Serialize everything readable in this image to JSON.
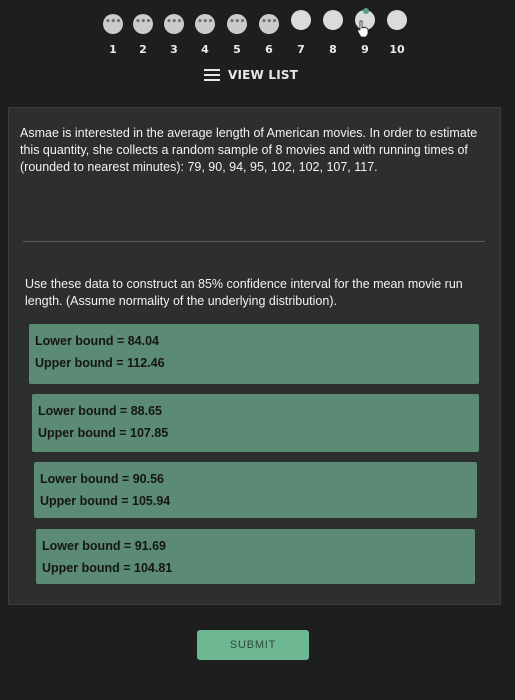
{
  "nav": {
    "questions": [
      {
        "label": "1",
        "state": "done",
        "dots": "•••"
      },
      {
        "label": "2",
        "state": "done",
        "dots": "•••"
      },
      {
        "label": "3",
        "state": "done",
        "dots": "•••"
      },
      {
        "label": "4",
        "state": "done",
        "dots": "•••"
      },
      {
        "label": "5",
        "state": "done",
        "dots": "•••"
      },
      {
        "label": "6",
        "state": "done",
        "dots": "•••"
      },
      {
        "label": "7",
        "state": "todo",
        "dots": ""
      },
      {
        "label": "8",
        "state": "todo",
        "dots": ""
      },
      {
        "label": "9",
        "state": "current",
        "dots": ""
      },
      {
        "label": "10",
        "state": "todo",
        "dots": ""
      }
    ],
    "view_list_label": "VIEW LIST"
  },
  "question": {
    "intro": "Asmae is interested in the average length of American movies. In order to estimate this quantity, she collects a random sample of 8 movies and with running times of (rounded to nearest minutes): 79, 90, 94, 95, 102, 102, 107, 117.",
    "prompt": "Use these data to construct an 85% confidence interval for the mean movie run length. (Assume normality of the underlying distribution)."
  },
  "options": [
    {
      "lower": "Lower bound = 84.04",
      "upper": "Upper bound = 112.46"
    },
    {
      "lower": "Lower bound = 88.65",
      "upper": "Upper bound = 107.85"
    },
    {
      "lower": "Lower bound = 90.56",
      "upper": "Upper bound = 105.94"
    },
    {
      "lower": "Lower bound = 91.69",
      "upper": "Upper bound = 104.81"
    }
  ],
  "submit_label": "SUBMIT",
  "colors": {
    "background": "#1d1f1e",
    "card": "#2c2f2d",
    "option": "#5b8b75",
    "submit": "#6db893",
    "done_dot": "#c9ccc9"
  }
}
